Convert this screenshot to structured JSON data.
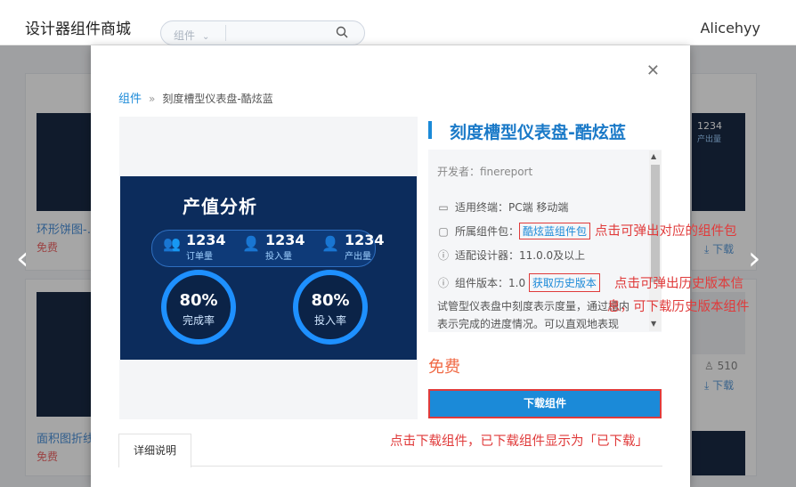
{
  "header": {
    "brand": "设计器组件商城",
    "search_select": "组件",
    "search_placeholder": "",
    "user": "Alicehyy"
  },
  "background": {
    "card1": {
      "title": "环形饼图-…",
      "price": "免费"
    },
    "card2": {
      "title": "面积图折线…",
      "price": "免费"
    },
    "right1": {
      "num": "1234",
      "label": "产出量",
      "dl": "下载"
    },
    "right2": {
      "count": "510",
      "dl": "下载"
    }
  },
  "modal": {
    "breadcrumb": {
      "root": "组件",
      "sep": "»",
      "current": "刻度槽型仪表盘-酷炫蓝"
    },
    "title": "刻度槽型仪表盘-酷炫蓝",
    "preview": {
      "heading": "产值分析",
      "stats": [
        {
          "num": "1234",
          "label": "订单量"
        },
        {
          "num": "1234",
          "label": "投入量"
        },
        {
          "num": "1234",
          "label": "产出量"
        }
      ],
      "rings": [
        {
          "pct": "80%",
          "label": "完成率"
        },
        {
          "pct": "80%",
          "label": "投入率"
        }
      ]
    },
    "info": {
      "developer": "开发者：finereport",
      "terminal": "适用终端：PC端   移动端",
      "package_label": "所属组件包：",
      "package_value": "酷炫蓝组件包",
      "designer": "适配设计器：11.0.0及以上",
      "version_label": "组件版本：1.0",
      "version_link": "获取历史版本",
      "description": "试管型仪表盘中刻度表示度量，通过槽内表示完成的进度情况。可以直观地表现"
    },
    "price": "免费",
    "download_button": "下载组件",
    "tab": "详细说明"
  },
  "annotations": {
    "package": "点击可弹出对应的组件包",
    "version_1": "点击可弹出历史版本信",
    "version_2": "息，可下载历史版本组件",
    "download": "点击下载组件，已下载组件显示为「已下载」"
  }
}
